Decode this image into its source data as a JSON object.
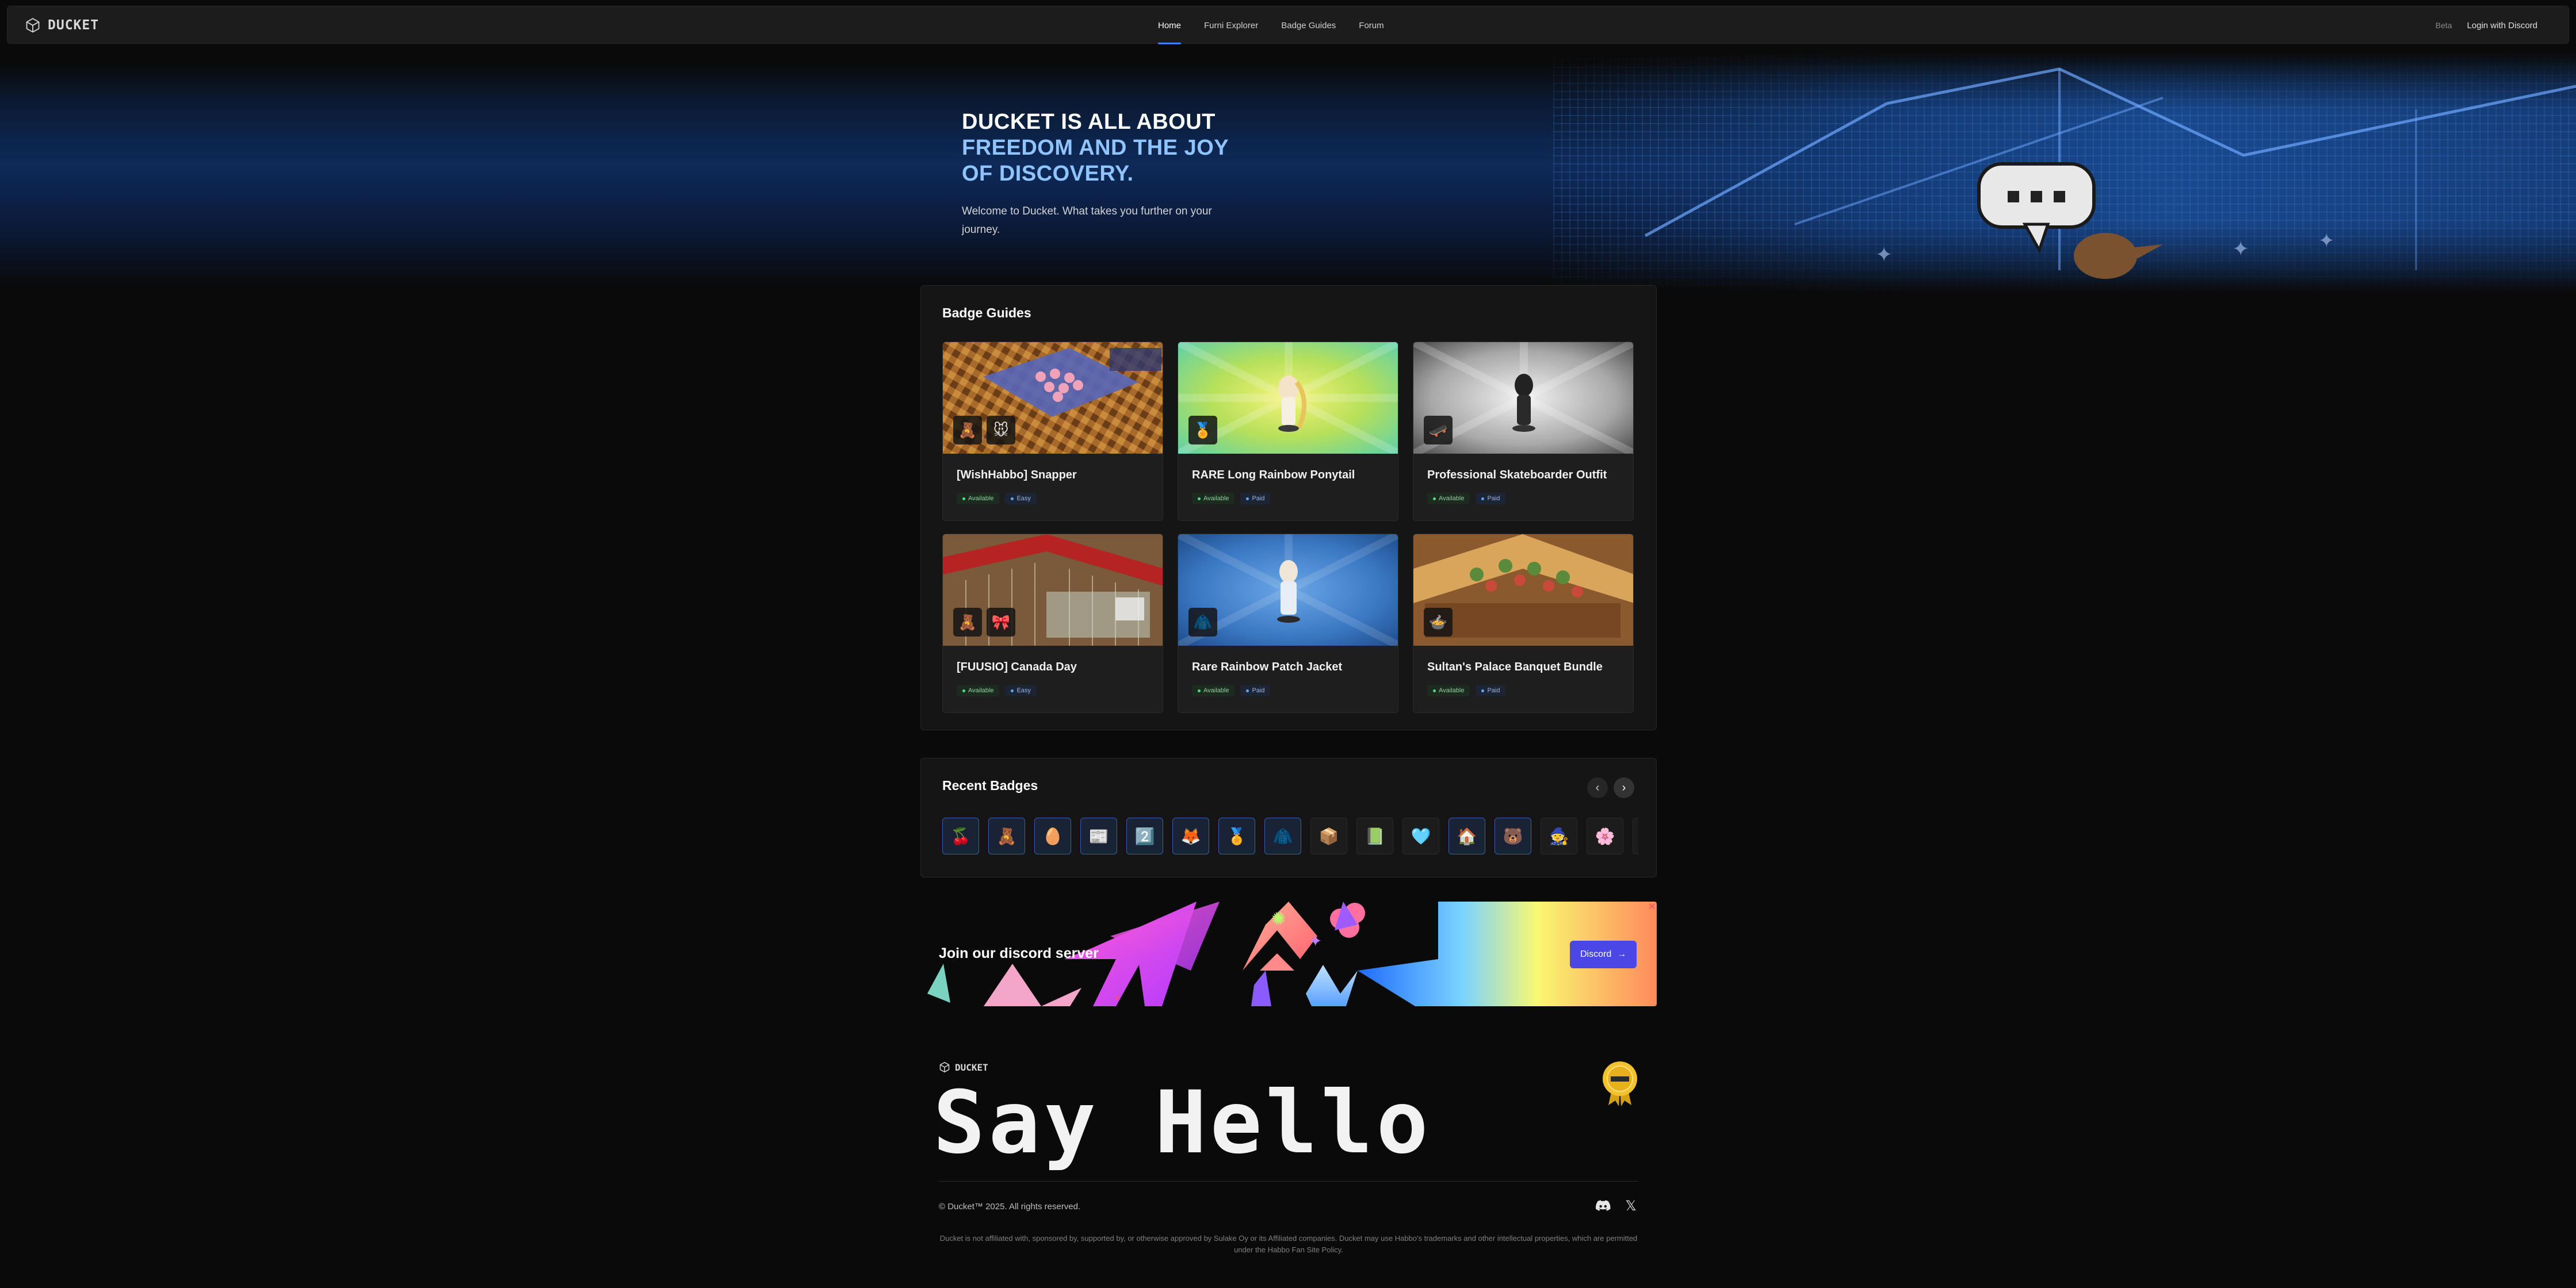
{
  "nav": {
    "brand": "DUCKET",
    "links": [
      "Home",
      "Furni Explorer",
      "Badge Guides",
      "Forum"
    ],
    "beta": "Beta",
    "login": "Login with Discord"
  },
  "hero": {
    "title_line1": "DUCKET IS ALL ABOUT",
    "title_accent": "FREEDOM AND THE JOY OF DISCOVERY.",
    "subtitle": "Welcome to Ducket. What takes you further on your journey."
  },
  "badge_guides": {
    "title": "Badge Guides",
    "cards": [
      {
        "title": "[WishHabbo] Snapper",
        "status": "Available",
        "difficulty": "Easy"
      },
      {
        "title": "RARE Long Rainbow Ponytail",
        "status": "Available",
        "difficulty": "Paid"
      },
      {
        "title": "Professional Skateboarder Outfit",
        "status": "Available",
        "difficulty": "Paid"
      },
      {
        "title": "[FUUSIO] Canada Day",
        "status": "Available",
        "difficulty": "Easy"
      },
      {
        "title": "Rare Rainbow Patch Jacket",
        "status": "Available",
        "difficulty": "Paid"
      },
      {
        "title": "Sultan's Palace Banquet Bundle",
        "status": "Available",
        "difficulty": "Paid"
      }
    ]
  },
  "recent_badges": {
    "title": "Recent Badges",
    "prev": "‹",
    "next": "›",
    "badges": [
      "🍒",
      "🧸",
      "🥚",
      "📰",
      "2️⃣",
      "🦊",
      "🏅",
      "🧥",
      "📦",
      "📗",
      "🩵",
      "🏠",
      "🐻",
      "🧙",
      "🌸"
    ]
  },
  "discord": {
    "text": "Join our discord server",
    "button": "Discord",
    "button_arrow": "→"
  },
  "footer": {
    "brand": "DUCKET",
    "say_hello": "Say Hello",
    "copyright": "© Ducket™ 2025. All rights reserved.",
    "disclaimer": "Ducket is not affiliated with, sponsored by, supported by, or otherwise approved by Sulake Oy or its Affiliated companies. Ducket may use Habbo's trademarks and other intellectual properties, which are permitted under the Habbo Fan Site Policy.",
    "x_glyph": "𝕏"
  },
  "colors": {
    "accent_blue": "#3b82f6",
    "hero_accent": "#8fc4ff",
    "discord_button": "#4a47e6",
    "status_green": "#4ade80"
  },
  "icons": {
    "brand": "cube-icon",
    "prev": "chevron-left-icon",
    "next": "chevron-right-icon",
    "discord": "discord-icon",
    "x": "x-logo-icon"
  }
}
